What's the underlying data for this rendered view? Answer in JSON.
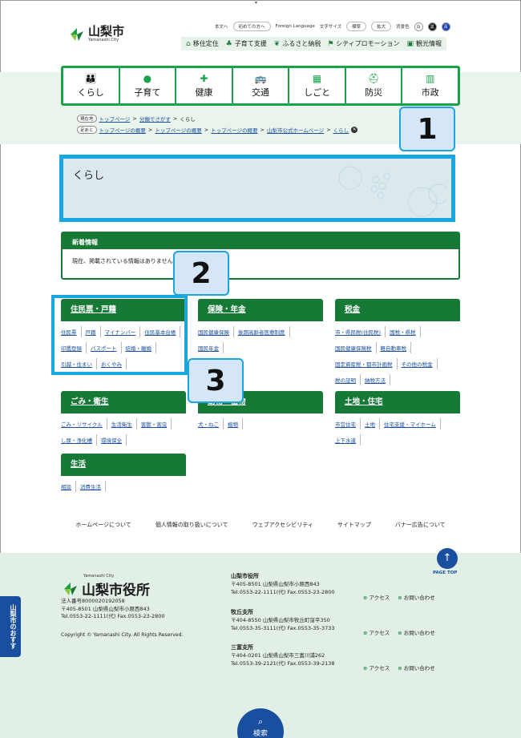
{
  "header": {
    "logo_name": "山梨市",
    "logo_sub": "Yamanashi City",
    "util": {
      "text_only": "本文へ",
      "first_time": "初めての方へ",
      "foreign": "Foreign Language",
      "font_size": "文字サイズ",
      "standard": "標準",
      "enlarge": "拡大",
      "bg_color": "背景色",
      "white": "白",
      "black": "黒",
      "blue": "青"
    },
    "topnav": [
      "移住定住",
      "子育て支援",
      "ふるさと納税",
      "シティプロモーション",
      "観光情報"
    ]
  },
  "mainnav": [
    {
      "label": "くらし",
      "icon": "👪"
    },
    {
      "label": "子育て",
      "icon": "●"
    },
    {
      "label": "健康",
      "icon": "✚"
    },
    {
      "label": "交通",
      "icon": "🚌"
    },
    {
      "label": "しごと",
      "icon": "▦"
    },
    {
      "label": "防災",
      "icon": "⛑"
    },
    {
      "label": "市政",
      "icon": "▥"
    }
  ],
  "breadcrumb1": {
    "tag": "現在地",
    "items": [
      "トップページ",
      "分類でさがす"
    ],
    "current": "くらし"
  },
  "breadcrumb2": {
    "tag": "足あと",
    "items": [
      "トップページの概要",
      "トップページの概要",
      "トップページの概要",
      "山梨市公式ホームページ",
      "くらし"
    ]
  },
  "page_title": "くらし",
  "callouts": [
    "1",
    "2",
    "3"
  ],
  "news": {
    "heading": "新着情報",
    "body": "現在、掲載されている情報はありません。"
  },
  "categories": [
    {
      "title": "住民票・戸籍",
      "links": [
        "住民票",
        "戸籍",
        "マイナンバー",
        "住民基本台帳",
        "印鑑登録",
        "パスポート",
        "結婚・離婚",
        "引越・住まい",
        "おくやみ"
      ]
    },
    {
      "title": "保険・年金",
      "links": [
        "国民健康保険",
        "後期高齢者医療制度",
        "国民年金"
      ]
    },
    {
      "title": "税金",
      "links": [
        "市・県民税(住民税)",
        "国税・県税",
        "国民健康保険税",
        "軽自動車税",
        "固定資産税・都市計画税",
        "その他の税金",
        "税の証明",
        "納税方法"
      ]
    },
    {
      "title": "ごみ・衛生",
      "links": [
        "ごみ・リサイクル",
        "生活衛生",
        "害獣・害虫",
        "し尿・浄化槽",
        "環境保全"
      ]
    },
    {
      "title": "動物・植物",
      "links": [
        "犬・ねこ",
        "植物"
      ]
    },
    {
      "title": "土地・住宅",
      "links": [
        "市営住宅",
        "土地",
        "住宅支援・マイホーム",
        "上下水道"
      ]
    },
    {
      "title": "生活",
      "links": [
        "相談",
        "消費生活"
      ]
    }
  ],
  "footer_nav": [
    "ホームページについて",
    "個人情報の取り扱いについて",
    "ウェブアクセシビリティ",
    "サイトマップ",
    "バナー広告について"
  ],
  "pagetop": "PAGE TOP",
  "footer": {
    "small": "Yamanashi City",
    "name": "山梨市役所",
    "corp_no": "法人番号8000020192058",
    "address": "〒405-8501 山梨県山梨市小原西843",
    "tel": "Tel.0553-22-1111(代) Fax.0553-23-2800",
    "copyright": "Copyright © Yamanashi City. All Rights Reserved.",
    "offices": [
      {
        "name": "山梨市役所",
        "addr": "〒405-8501 山梨県山梨市小原西843",
        "tel": "Tel.0553-22-1111(代) Fax.0553-23-2800"
      },
      {
        "name": "牧丘支所",
        "addr": "〒404-8550 山梨県山梨市牧丘町窪平350",
        "tel": "Tel.0553-35-3111(代) Fax.0553-35-3733"
      },
      {
        "name": "三富支所",
        "addr": "〒404-0201 山梨県山梨市三富川浦262",
        "tel": "Tel.0553-39-2121(代) Fax.0553-39-2138"
      }
    ],
    "access": "アクセス",
    "contact": "お問い合わせ"
  },
  "side_tab": "山梨市のおすすめ",
  "search_label": "検索",
  "colors": {
    "green": "#167a36",
    "nav_green": "#19a24a",
    "blue": "#1a4fa0",
    "highlight": "#1aa6e0"
  }
}
